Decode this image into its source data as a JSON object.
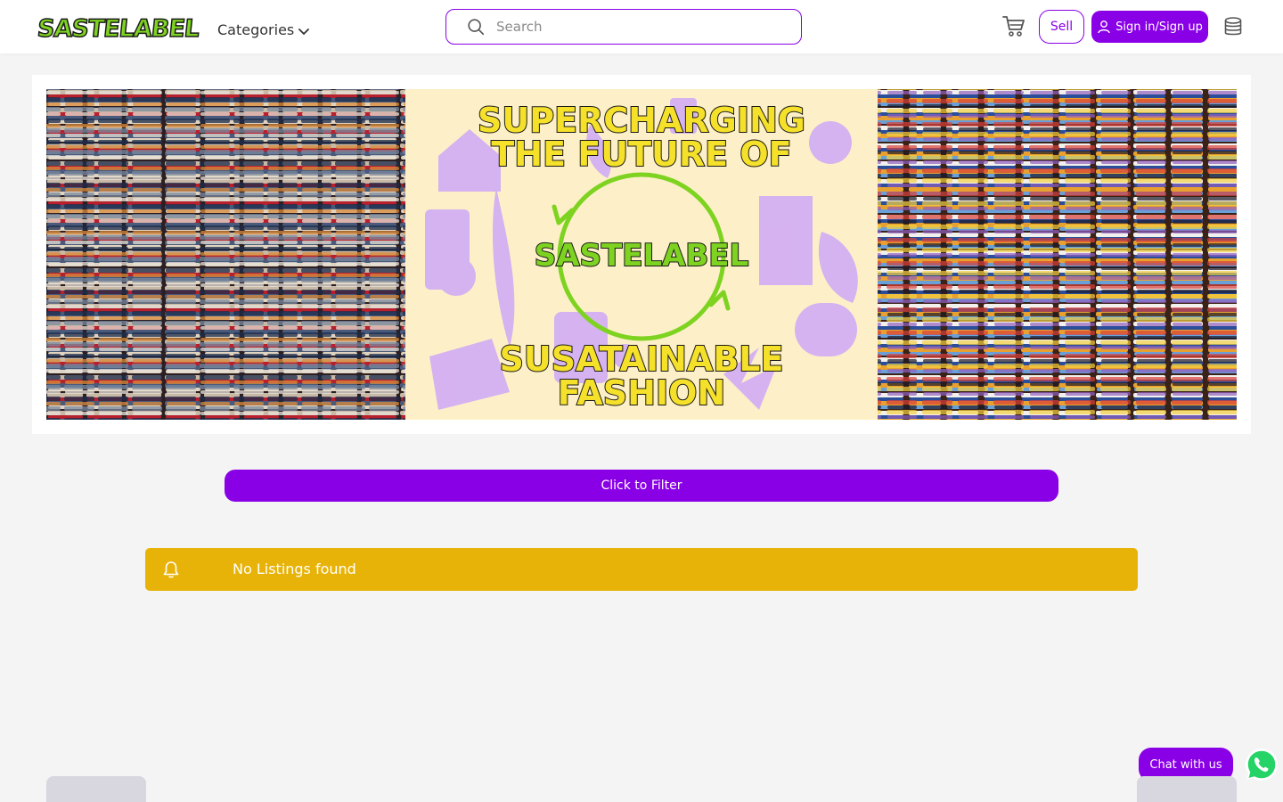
{
  "header": {
    "logo_text": "SASTELABEL",
    "categories_label": "Categories",
    "search": {
      "placeholder": "Search",
      "value": ""
    },
    "sell_label": "Sell",
    "signin_label": "Sign in/Sign up"
  },
  "banner": {
    "headline_top_1": "SUPERCHARGING",
    "headline_top_2": "THE FUTURE OF",
    "brand": "SASTELABEL",
    "headline_bottom_1": "SUSATAINABLE",
    "headline_bottom_2": "FASHION"
  },
  "filter": {
    "label": "Click to Filter"
  },
  "alert": {
    "message": "No Listings found",
    "icon": "bell-icon"
  },
  "chat": {
    "label": "Chat with us",
    "icon": "whatsapp-icon"
  },
  "colors": {
    "accent": "#8a00e6",
    "alert": "#e8b308",
    "brand_green": "#7ed321",
    "banner_bg": "#fdf0c8",
    "banner_pattern": "#cfa8f7",
    "headline_yellow": "#f5e02a",
    "whatsapp": "#25d366"
  }
}
